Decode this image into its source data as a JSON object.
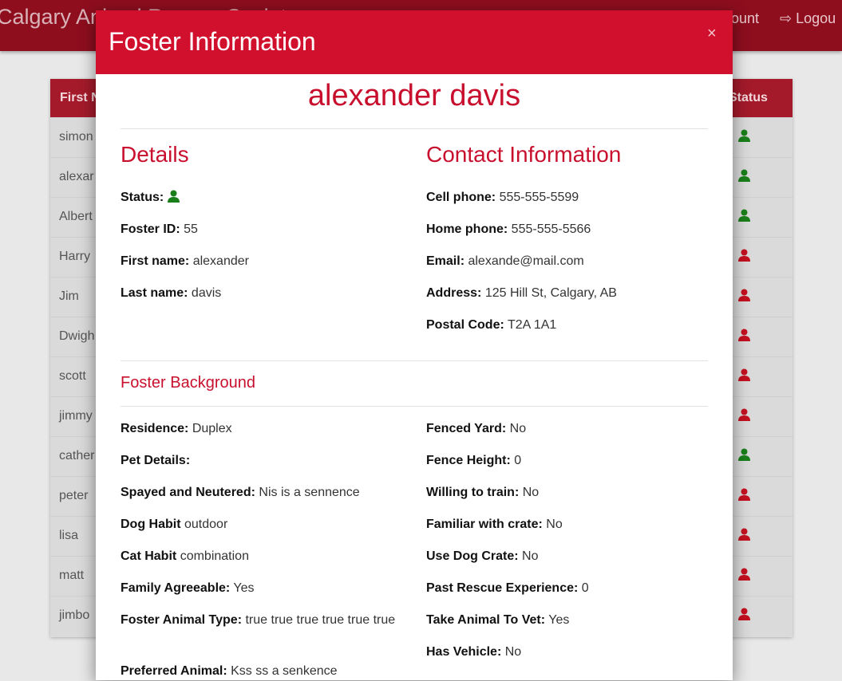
{
  "app": {
    "brand": "Calgary Animal Rescue Society",
    "nav_account": "ount",
    "nav_logout": "Logou"
  },
  "table": {
    "header_first": "First N",
    "header_status": "Status",
    "rows": [
      {
        "name": "simon",
        "status": "active"
      },
      {
        "name": "alexar",
        "status": "active"
      },
      {
        "name": "Albert",
        "status": "active"
      },
      {
        "name": "Harry",
        "status": "inactive"
      },
      {
        "name": "Jim",
        "status": "inactive"
      },
      {
        "name": "Dwigh",
        "status": "inactive"
      },
      {
        "name": "scott",
        "status": "inactive"
      },
      {
        "name": "jimmy",
        "status": "inactive"
      },
      {
        "name": "cather",
        "status": "active"
      },
      {
        "name": "peter",
        "status": "inactive"
      },
      {
        "name": "lisa",
        "status": "inactive"
      },
      {
        "name": "matt",
        "status": "inactive"
      },
      {
        "name": "jimbo",
        "status": "inactive"
      }
    ]
  },
  "colors": {
    "accent": "#c8102e",
    "header": "#d1102d",
    "active": "#1a7f1a",
    "inactive": "#c41020"
  },
  "modal": {
    "title": "Foster Information",
    "close": "×",
    "name": "alexander davis",
    "details_heading": "Details",
    "contact_heading": "Contact Information",
    "background_heading": "Foster Background",
    "status_label": "Status:",
    "details": [
      {
        "label": "Foster ID:",
        "value": "55"
      },
      {
        "label": "First name:",
        "value": "alexander"
      },
      {
        "label": "Last name:",
        "value": "davis"
      }
    ],
    "contact": [
      {
        "label": "Cell phone:",
        "value": "555-555-5599"
      },
      {
        "label": "Home phone:",
        "value": "555-555-5566"
      },
      {
        "label": "Email:",
        "value": "alexande@mail.com"
      },
      {
        "label": "Address:",
        "value": "125 Hill St, Calgary, AB"
      },
      {
        "label": "Postal Code:",
        "value": "T2A 1A1"
      }
    ],
    "background_left": [
      {
        "label": "Residence:",
        "value": "Duplex"
      },
      {
        "label": "Pet Details:",
        "value": ""
      },
      {
        "label": "Spayed and Neutered:",
        "value": "Nis is a sennence"
      },
      {
        "label": "Dog Habit",
        "value": "outdoor"
      },
      {
        "label": "Cat Habit",
        "value": "combination"
      },
      {
        "label": "Family Agreeable:",
        "value": "Yes"
      },
      {
        "label": "Foster Animal Type:",
        "value": "true true true true true true"
      },
      {
        "label": "Preferred Animal:",
        "value": "Kss ss a senkence"
      }
    ],
    "background_right": [
      {
        "label": "Fenced Yard:",
        "value": "No"
      },
      {
        "label": "Fence Height:",
        "value": "0"
      },
      {
        "label": "Willing to train:",
        "value": "No"
      },
      {
        "label": "Familiar with crate:",
        "value": "No"
      },
      {
        "label": "Use Dog Crate:",
        "value": "No"
      },
      {
        "label": "Past Rescue Experience:",
        "value": "0"
      },
      {
        "label": "Take Animal To Vet:",
        "value": "Yes"
      },
      {
        "label": "Has Vehicle:",
        "value": "No"
      }
    ]
  }
}
